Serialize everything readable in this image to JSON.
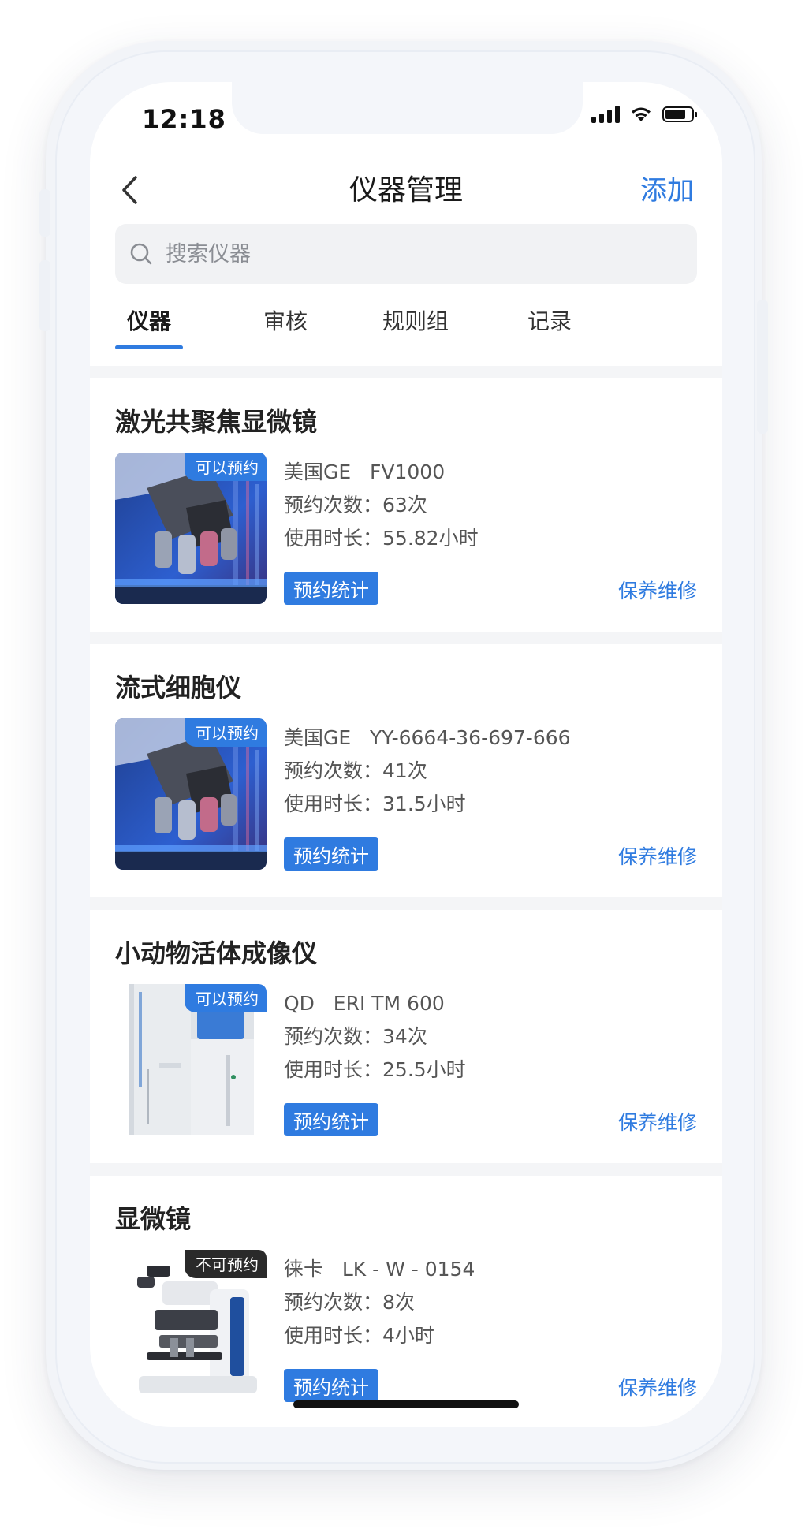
{
  "status_bar": {
    "time": "12:18"
  },
  "nav": {
    "title": "仪器管理",
    "add_label": "添加"
  },
  "search": {
    "placeholder": "搜索仪器"
  },
  "tabs": [
    {
      "label": "仪器",
      "active": true
    },
    {
      "label": "审核",
      "active": false
    },
    {
      "label": "规则组",
      "active": false
    },
    {
      "label": "记录",
      "active": false
    }
  ],
  "instruments": [
    {
      "name": "激光共聚焦显微镜",
      "badge": "可以预约",
      "brand": "美国GE",
      "model": "FV1000",
      "bookings_label": "预约次数：",
      "bookings": "63次",
      "usage_label": "使用时长：",
      "usage": "55.82小时",
      "stat_button": "预约统计",
      "maint_link": "保养维修"
    },
    {
      "name": "流式细胞仪",
      "badge": "可以预约",
      "brand": "美国GE",
      "model": "YY-6664-36-697-666",
      "bookings_label": "预约次数：",
      "bookings": "41次",
      "usage_label": "使用时长：",
      "usage": "31.5小时",
      "stat_button": "预约统计",
      "maint_link": "保养维修"
    },
    {
      "name": "小动物活体成像仪",
      "badge": "可以预约",
      "brand": "QD",
      "model": "ERI TM 600",
      "bookings_label": "预约次数：",
      "bookings": "34次",
      "usage_label": "使用时长：",
      "usage": "25.5小时",
      "stat_button": "预约统计",
      "maint_link": "保养维修"
    },
    {
      "name": "显微镜",
      "badge": "不可预约",
      "brand": "徕卡",
      "model": "LK - W - 0154",
      "bookings_label": "预约次数：",
      "bookings": "8次",
      "usage_label": "使用时长：",
      "usage": "4小时",
      "stat_button": "预约统计",
      "maint_link": "保养维修"
    }
  ],
  "colors": {
    "accent": "#2f7be0",
    "badge_unavailable": "#2a2a2a"
  }
}
